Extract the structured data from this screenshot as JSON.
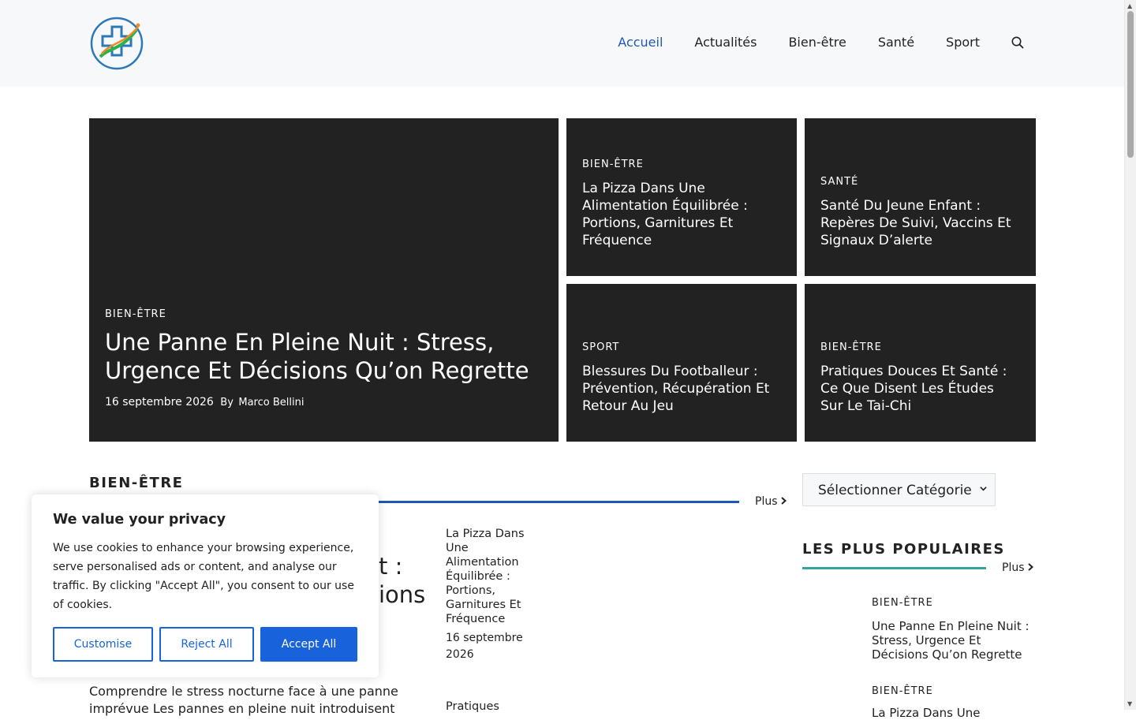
{
  "header": {
    "logo_icon": "medical-cross-logo",
    "nav": [
      "Accueil",
      "Actualités",
      "Bien-être",
      "Santé",
      "Sport"
    ],
    "active_nav": "Accueil",
    "search_icon": "search-icon"
  },
  "hero": {
    "main": {
      "category": "BIEN-ÊTRE",
      "title": "Une Panne En Pleine Nuit : Stress, Urgence Et Décisions Qu’on Regrette",
      "date": "16 septembre 2026",
      "by": "By",
      "author": "Marco Bellini"
    },
    "tiles": [
      {
        "category": "BIEN-ÊTRE",
        "title": "La Pizza Dans Une Alimentation Équilibrée : Portions, Garnitures Et Fréquence"
      },
      {
        "category": "SANTÉ",
        "title": "Santé Du Jeune Enfant : Repères De Suivi, Vaccins Et Signaux D’alerte"
      },
      {
        "category": "SPORT",
        "title": "Blessures Du Footballeur : Prévention, Récupération Et Retour Au Jeu"
      },
      {
        "category": "BIEN-ÊTRE",
        "title": "Pratiques Douces Et Santé : Ce Que Disent Les Études Sur Le Tai-Chi"
      }
    ]
  },
  "section": {
    "title": "BIEN-ÊTRE",
    "more": "Plus",
    "featured_title_visible": "t :\nions",
    "excerpt": "Comprendre le stress nocturne face à une panne imprévue Les pannes en pleine nuit introduisent",
    "list": [
      {
        "title": "La Pizza Dans Une Alimentation Équilibrée : Portions, Garnitures Et Fréquence",
        "date": "16 septembre 2026"
      },
      {
        "title": "Pratiques"
      }
    ]
  },
  "sidebar": {
    "select_value": "Sélectionner Catégorie",
    "popular_title": "LES PLUS POPULAIRES",
    "more": "Plus",
    "items": [
      {
        "category": "BIEN-ÊTRE",
        "title": "Une Panne En Pleine Nuit : Stress, Urgence Et Décisions Qu’on Regrette"
      },
      {
        "category": "BIEN-ÊTRE",
        "title": "La Pizza Dans Une"
      }
    ]
  },
  "cookie": {
    "title": "We value your privacy",
    "text": "We use cookies to enhance your browsing experience, serve personalised ads or content, and analyse our traffic. By clicking \"Accept All\", you consent to our use of cookies.",
    "customise": "Customise",
    "reject": "Reject All",
    "accept": "Accept All"
  },
  "colors": {
    "accent": "#1e58b5",
    "teal": "#33a39b",
    "tile_bg": "#222222",
    "cookie_button": "#1863dc"
  }
}
